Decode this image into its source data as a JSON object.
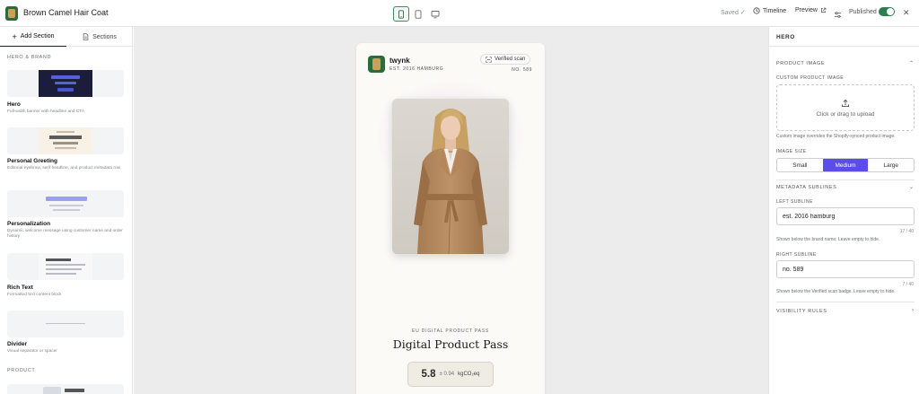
{
  "app": {
    "title": "Brown Camel Hair Coat"
  },
  "toolbar": {
    "saved": "Saved ✓",
    "timeline": "Timeline",
    "preview": "Preview",
    "published": "Published",
    "published_on": true,
    "accent": "#2e7d4f"
  },
  "sidebar": {
    "tabs": [
      {
        "label": "Add Section",
        "icon": "plus-icon",
        "active": true
      },
      {
        "label": "Sections",
        "icon": "document-icon",
        "active": false
      }
    ],
    "group_hero": "HERO & BRAND",
    "group_product": "PRODUCT",
    "cards": [
      {
        "name": "Hero",
        "description": "Full-width banner with headline and CTA"
      },
      {
        "name": "Personal Greeting",
        "description": "Editorial eyebrow, serif headline, and product metadata row"
      },
      {
        "name": "Personalization",
        "description": "Dynamic welcome message using customer name and order history"
      },
      {
        "name": "Rich Text",
        "description": "Formatted text content block"
      },
      {
        "name": "Divider",
        "description": "Visual separator or spacer"
      }
    ]
  },
  "preview": {
    "brand_name": "twynk",
    "brand_sub": "EST. 2016 HAMBURG",
    "verified_label": "Verified scan",
    "scan_number": "NO. 589",
    "eyebrow": "EU DIGITAL PRODUCT PASS",
    "title": "Digital Product Pass",
    "co2_value": "5.8",
    "co2_uncertainty": "± 0.94",
    "co2_unit": "kgCO₂eq"
  },
  "panel": {
    "header": "HERO",
    "product_image_section": "PRODUCT IMAGE",
    "custom_image_label": "CUSTOM PRODUCT IMAGE",
    "upload_text": "Click or drag to upload",
    "upload_help": "Custom image overrides the Shopify-synced product image.",
    "image_size_label": "IMAGE SIZE",
    "image_sizes": [
      "Small",
      "Medium",
      "Large"
    ],
    "image_size_selected": "Medium",
    "metadata_section": "METADATA SUBLINES",
    "left_subline_label": "LEFT SUBLINE",
    "left_subline_value": "est. 2016 hamburg",
    "left_subline_count": "17 / 40",
    "left_subline_help": "Shown below the brand name. Leave empty to hide.",
    "right_subline_label": "RIGHT SUBLINE",
    "right_subline_value": "no. 589",
    "right_subline_count": "7 / 40",
    "right_subline_help": "Shown below the Verified scan badge. Leave empty to hide.",
    "visibility_section": "VISIBILITY RULES",
    "segment_color": "#5b4dea"
  }
}
